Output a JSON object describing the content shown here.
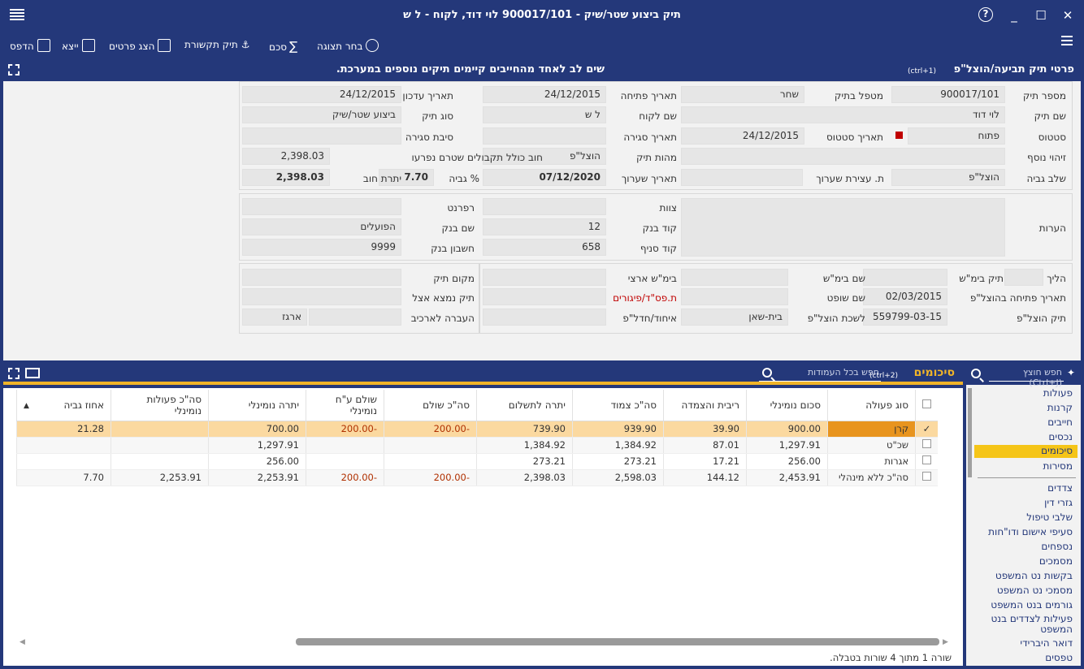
{
  "window": {
    "title": "תיק ביצוע שטר/שיק - 900017/101 לוי דוד, לקוח - ל ש",
    "help": "?",
    "minimize": "_",
    "maximize": "☐",
    "close": "✕"
  },
  "toolbar": {
    "choose_view": "בחר תצוגה",
    "sum": "סכם",
    "link_file": "תיק תקשורת",
    "show_details": "הצג פרטים",
    "export": "ייצא",
    "print": "הדפס"
  },
  "section": {
    "title": "פרטי תיק תביעה/הוצל\"פ",
    "shortcut": "(ctrl+1)",
    "warning": "שים לב לאחד מהחייבים קיימים תיקים נוספים במערכת."
  },
  "fields": {
    "file_number_label": "מספר תיק",
    "file_number": "900017/101",
    "handler_label": "מטפל בתיק",
    "handler": "שחר",
    "open_date_label": "תאריך פתיחה",
    "open_date": "24/12/2015",
    "update_date_label": "תאריך עדכון",
    "update_date": "24/12/2015",
    "file_name_label": "שם תיק",
    "file_name": "לוי דוד",
    "client_name_label": "שם לקוח",
    "client_name": "ל ש",
    "file_type_label": "סוג תיק",
    "file_type": "ביצוע שטר/שיק",
    "status_label": "סטטוס",
    "status": "פתוח",
    "status_date_label": "תאריך סטטוס",
    "status_date": "24/12/2015",
    "close_date_label": "תאריך סגירה",
    "close_date": "",
    "close_reason_label": "סיבת סגירה",
    "close_reason": "",
    "extra_id_label": "זיהוי נוסף",
    "extra_id": "",
    "file_nature_label": "מהות תיק",
    "file_nature": "הוצל\"פ",
    "debt_incl_label": "חוב כולל תקבולים שטרם נפרעו",
    "debt_incl": "2,398.03",
    "collection_stage_label": "שלב גביה",
    "collection_stage": "הוצל\"פ",
    "appeal_stop_label": "ת. עצירת שערוך",
    "appeal_stop": "",
    "appeal_date_label": "תאריך שערוך",
    "appeal_date": "07/12/2020",
    "collection_pct_label": "% גביה",
    "collection_pct": "7.70",
    "debt_balance_label": "יתרת חוב",
    "debt_balance": "2,398.03",
    "notes_label": "הערות",
    "team_label": "צוות",
    "referent_label": "רפרנט",
    "bank_code_label": "קוד בנק",
    "bank_code": "12",
    "bank_name_label": "שם בנק",
    "bank_name": "הפועלים",
    "branch_code_label": "קוד סניף",
    "branch_code": "658",
    "bank_account_label": "חשבון בנק",
    "bank_account": "9999",
    "procedure_label": "הליך",
    "court_file_label": "תיק בימ\"ש",
    "court_name_label": "שם בימ\"ש",
    "court_region_label": "בימ\"ש ארצי",
    "file_location_label": "מקום תיק",
    "exec_open_date_label": "תאריך פתיחה בהוצל\"פ",
    "exec_open_date": "02/03/2015",
    "judge_name_label": "שם שופט",
    "red_link": "ת.פס\"ד/פיגורים",
    "file_at_label": "תיק נמצא אצל",
    "exec_file_label": "תיק הוצל\"פ",
    "exec_file": "559799-03-15",
    "exec_office_label": "לשכת הוצל\"פ",
    "exec_office": "בית-שאן",
    "merge_label": "איחוד/חדל\"פ",
    "archive_label": "העברה לארכיב",
    "archive_box": "ארגז"
  },
  "summary": {
    "title": "סיכומים",
    "shortcut": "(ctrl+2)",
    "search_placeholder": "חפש בכל העמודות",
    "columns": [
      "סוג פעולה",
      "סכום נומינלי",
      "ריבית והצמדה",
      "סה\"כ צמוד",
      "יתרה לתשלום",
      "סה\"כ שולם",
      "שולם ע\"ח נומינלי",
      "יתרה נומינלי",
      "סה\"כ פעולות נומינלי",
      "אחוז גביה"
    ],
    "rows": [
      [
        "קרן",
        "900.00",
        "39.90",
        "939.90",
        "739.90",
        "-200.00",
        "-200.00",
        "700.00",
        "",
        "21.28"
      ],
      [
        "שכ\"ט",
        "1,297.91",
        "87.01",
        "1,384.92",
        "1,384.92",
        "",
        "",
        "1,297.91",
        "",
        ""
      ],
      [
        "אגרות",
        "256.00",
        "17.21",
        "273.21",
        "273.21",
        "",
        "",
        "256.00",
        "",
        ""
      ],
      [
        "סה\"כ ללא מינהלי",
        "2,453.91",
        "144.12",
        "2,598.03",
        "2,398.03",
        "-200.00",
        "-200.00",
        "2,253.91",
        "2,253.91",
        "7.70"
      ]
    ],
    "status": "שורה 1 מתוך 4 שורות בטבלה."
  },
  "sidebar": {
    "search_placeholder": "חפש חוצץ (Ctrl+J)",
    "items": [
      "פעולות",
      "קרנות",
      "חייבים",
      "נכסים",
      "סיכומים",
      "מסירות",
      "צדדים",
      "גזרי דין",
      "שלבי טיפול",
      "סעיפי אישום ודו\"חות",
      "נספחים",
      "מסמכים",
      "בקשות נט המשפט",
      "מסמכי נט המשפט",
      "גורמים בנט המשפט",
      "פעילות לצדדים בנט המשפט",
      "דואר היברידי",
      "טפסים"
    ]
  },
  "colors": {
    "navy": "#24387a",
    "accent": "#f0b429",
    "selected_row": "#fbd9a0",
    "selected_cell": "#e8941e",
    "negative": "#b03000"
  }
}
